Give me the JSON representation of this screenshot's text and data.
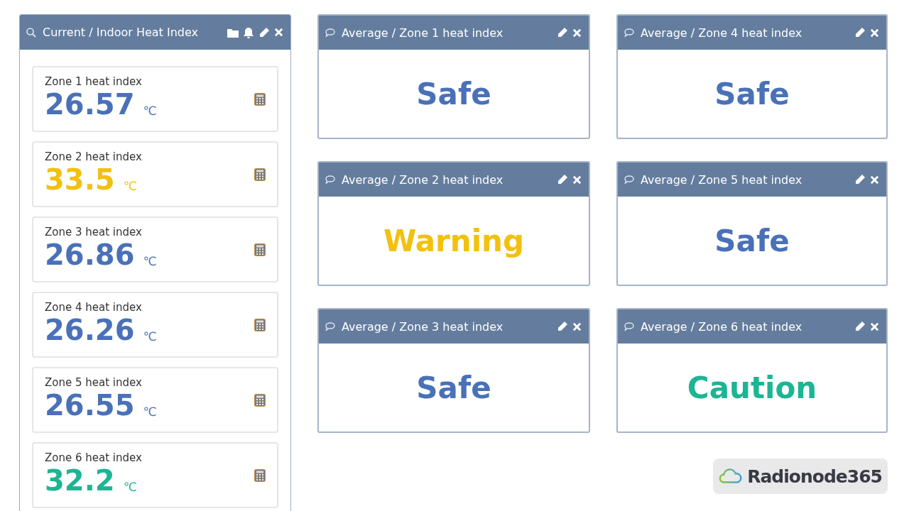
{
  "current_panel": {
    "title": "Current / Indoor Heat Index",
    "zones": [
      {
        "label": "Zone 1 heat index",
        "value": "26.57",
        "unit": "℃",
        "color": "#4a71b8"
      },
      {
        "label": "Zone 2 heat index",
        "value": "33.5",
        "unit": "℃",
        "color": "#f2c10f"
      },
      {
        "label": "Zone 3 heat index",
        "value": "26.86",
        "unit": "℃",
        "color": "#4a71b8"
      },
      {
        "label": "Zone 4 heat index",
        "value": "26.26",
        "unit": "℃",
        "color": "#4a71b8"
      },
      {
        "label": "Zone 5 heat index",
        "value": "26.55",
        "unit": "℃",
        "color": "#4a71b8"
      },
      {
        "label": "Zone 6 heat index",
        "value": "32.2",
        "unit": "℃",
        "color": "#1db594"
      }
    ]
  },
  "average_panels": [
    {
      "title": "Average / Zone 1 heat index",
      "status": "Safe",
      "color": "#4a71b8"
    },
    {
      "title": "Average / Zone 4 heat index",
      "status": "Safe",
      "color": "#4a71b8"
    },
    {
      "title": "Average / Zone 2 heat index",
      "status": "Warning",
      "color": "#f2c10f"
    },
    {
      "title": "Average / Zone 5 heat index",
      "status": "Safe",
      "color": "#4a71b8"
    },
    {
      "title": "Average / Zone 3 heat index",
      "status": "Safe",
      "color": "#4a71b8"
    },
    {
      "title": "Average / Zone 6 heat index",
      "status": "Caution",
      "color": "#1db594"
    }
  ],
  "logo": {
    "text": "Radionode365"
  }
}
